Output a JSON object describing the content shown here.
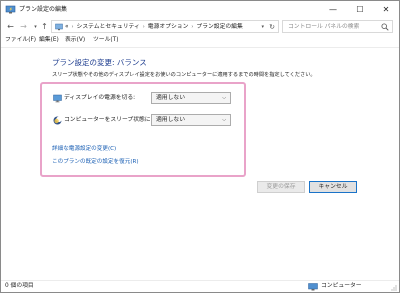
{
  "window": {
    "title": "プラン設定の編集",
    "controls": {
      "minimize": "—",
      "maximize": "☐",
      "close": "✕"
    }
  },
  "address_bar": {
    "breadcrumbs": [
      "«",
      "システムとセキュリティ",
      "電源オプション",
      "プラン設定の編集"
    ],
    "separator": "›",
    "search_placeholder": "コントロール パネルの検索"
  },
  "menu": [
    "ファイル(F)",
    "編集(E)",
    "表示(V)",
    "ツール(T)"
  ],
  "page": {
    "heading": "プラン設定の変更: バランス",
    "description": "スリープ状態やその他のディスプレイ設定をお使いのコンピューターに適用するまでの時間を指定してください。"
  },
  "settings": [
    {
      "label": "ディスプレイの電源を切る:",
      "value": "適用しない",
      "icon": "monitor-icon"
    },
    {
      "label": "コンピューターをスリープ状態にする:",
      "value": "適用しない",
      "icon": "moon-icon"
    }
  ],
  "links": {
    "advanced": "詳細な電源設定の変更(C)",
    "restore": "このプランの既定の設定を復元(R)"
  },
  "buttons": {
    "save": "変更の保存",
    "cancel": "キャンセル"
  },
  "status": {
    "item_count": "0 個の項目",
    "location": "コンピューター"
  },
  "colors": {
    "heading": "#1e3d8f",
    "link": "#1a5fb4",
    "highlight_border": "#e9a3c9"
  }
}
